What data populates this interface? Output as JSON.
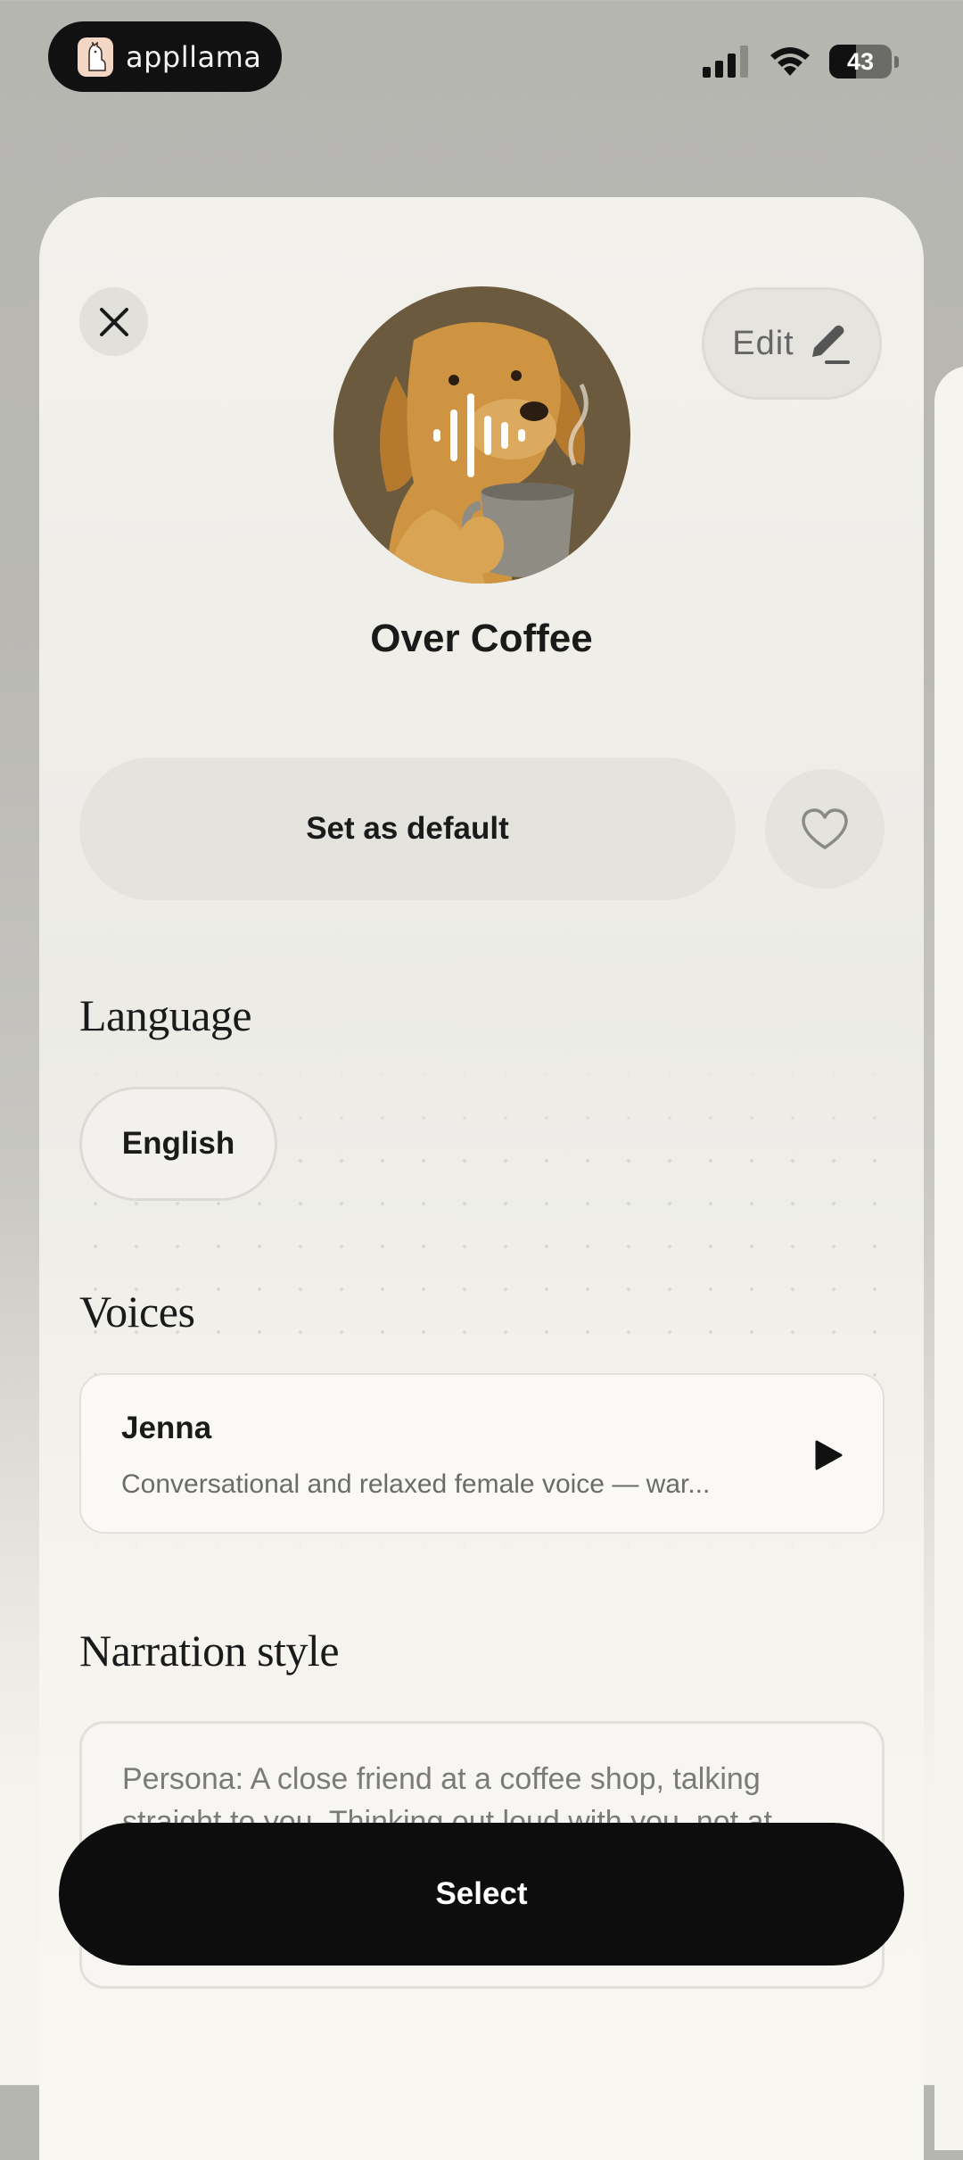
{
  "status_bar": {
    "app_name": "appllama",
    "battery_level": "43",
    "icons": [
      "signal-icon",
      "wifi-icon",
      "battery-icon"
    ]
  },
  "header": {
    "edit_label": "Edit",
    "title": "Over Coffee"
  },
  "actions": {
    "set_default_label": "Set as default"
  },
  "language": {
    "heading": "Language",
    "selected": "English"
  },
  "voices": {
    "heading": "Voices",
    "items": [
      {
        "name": "Jenna",
        "description": "Conversational and relaxed female voice — war..."
      }
    ]
  },
  "narration": {
    "heading": "Narration style",
    "text": "Persona: A close friend at a coffee shop, talking straight to you. Thinking out loud with you, not at"
  },
  "footer": {
    "select_label": "Select"
  },
  "colors": {
    "primary_button": "#0d0d0d",
    "sheet_background": "#f3f1ec",
    "chip_background": "#e5e3de"
  }
}
